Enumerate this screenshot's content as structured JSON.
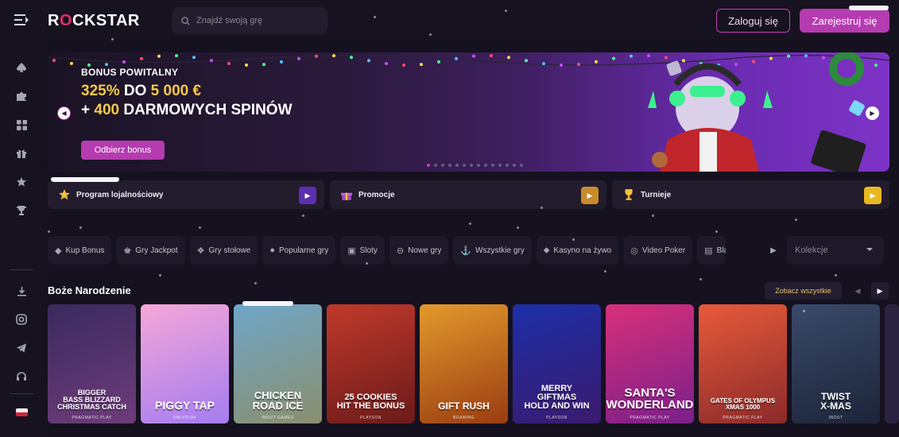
{
  "header": {
    "logo": "ROCKSTAR",
    "logo_parts": [
      "R",
      "O",
      "CKSTAR"
    ],
    "search_placeholder": "Znajdź swoją grę",
    "login_label": "Zaloguj się",
    "register_label": "Zarejestruj się"
  },
  "sidebar": {
    "top_icons": [
      "spade-icon",
      "puzzle-icon",
      "grid-icon",
      "gift-icon",
      "star-icon",
      "trophy-icon"
    ],
    "bottom_icons": [
      "download-icon",
      "instagram-icon",
      "telegram-icon",
      "headset-icon"
    ],
    "language": "pl"
  },
  "banner": {
    "label": "BONUS POWITALNY",
    "line1_pct": "325%",
    "line1_mid": " DO ",
    "line1_amount": "5 000 €",
    "line2_prefix": "+ ",
    "line2_num": "400",
    "line2_rest": " DARMOWYCH SPINÓW",
    "cta": "Odbierz bonus",
    "slide_count": 14,
    "active_slide": 0
  },
  "promos": [
    {
      "label": "Program lojalnościowy",
      "icon": "star-icon",
      "accent": "#5a2fb0"
    },
    {
      "label": "Promocje",
      "icon": "gift-icon",
      "accent": "#c98a2c"
    },
    {
      "label": "Turnieje",
      "icon": "trophy-icon",
      "accent": "#e8b820"
    }
  ],
  "categories": [
    {
      "label": "Kup Bonus",
      "icon": "diamond-icon"
    },
    {
      "label": "Gry Jackpot",
      "icon": "jackpot-icon"
    },
    {
      "label": "Gry stołowe",
      "icon": "table-games-icon"
    },
    {
      "label": "Popularne gry",
      "icon": "fire-icon"
    },
    {
      "label": "Sloty",
      "icon": "slots-icon"
    },
    {
      "label": "Nowe gry",
      "icon": "new-icon"
    },
    {
      "label": "Wszystkie gry",
      "icon": "all-games-icon"
    },
    {
      "label": "Kasyno na żywo",
      "icon": "live-casino-icon"
    },
    {
      "label": "Video Poker",
      "icon": "poker-icon"
    },
    {
      "label": "Bla",
      "icon": "blackjack-icon"
    }
  ],
  "collections_placeholder": "Kolekcje",
  "section": {
    "title": "Boże Narodzenie",
    "see_all": "Zobacz wszystkie"
  },
  "games": [
    {
      "name": "BIGGER\nBASS BLIZZARD\nCHRISTMAS CATCH",
      "provider": "PRAGMATIC PLAY",
      "colors": [
        "#3a2a5e",
        "#6e3c7a"
      ]
    },
    {
      "name": "PIGGY TAP",
      "provider": "ONLYPLAY",
      "colors": [
        "#f5a7d8",
        "#a57cf0"
      ]
    },
    {
      "name": "CHICKEN\nROAD ICE",
      "provider": "INOUT GAMES",
      "colors": [
        "#6fa6c9",
        "#8a8f6e"
      ]
    },
    {
      "name": "25 COOKIES\nHIT THE BONUS",
      "provider": "PLAYSON",
      "colors": [
        "#c1392b",
        "#6b1a1a"
      ]
    },
    {
      "name": "GIFT RUSH",
      "provider": "BGAMING",
      "colors": [
        "#e39a2c",
        "#9a3c12"
      ]
    },
    {
      "name": "MERRY\nGIFTMAS\nHOLD AND WIN",
      "provider": "PLAYSON",
      "colors": [
        "#1c2fa8",
        "#3b1a6e"
      ]
    },
    {
      "name": "SANTA'S\nWONDERLAND",
      "provider": "PRAGMATIC PLAY",
      "colors": [
        "#d8307a",
        "#7a1f8a"
      ]
    },
    {
      "name": "GATES OF OLYMPUS\nXMAS 1000",
      "provider": "PRAGMATIC PLAY",
      "colors": [
        "#e85a3a",
        "#8a2a2a"
      ]
    },
    {
      "name": "TWIST\nX-MAS",
      "provider": "INOUT",
      "colors": [
        "#3a4a6a",
        "#1c2438"
      ]
    }
  ]
}
